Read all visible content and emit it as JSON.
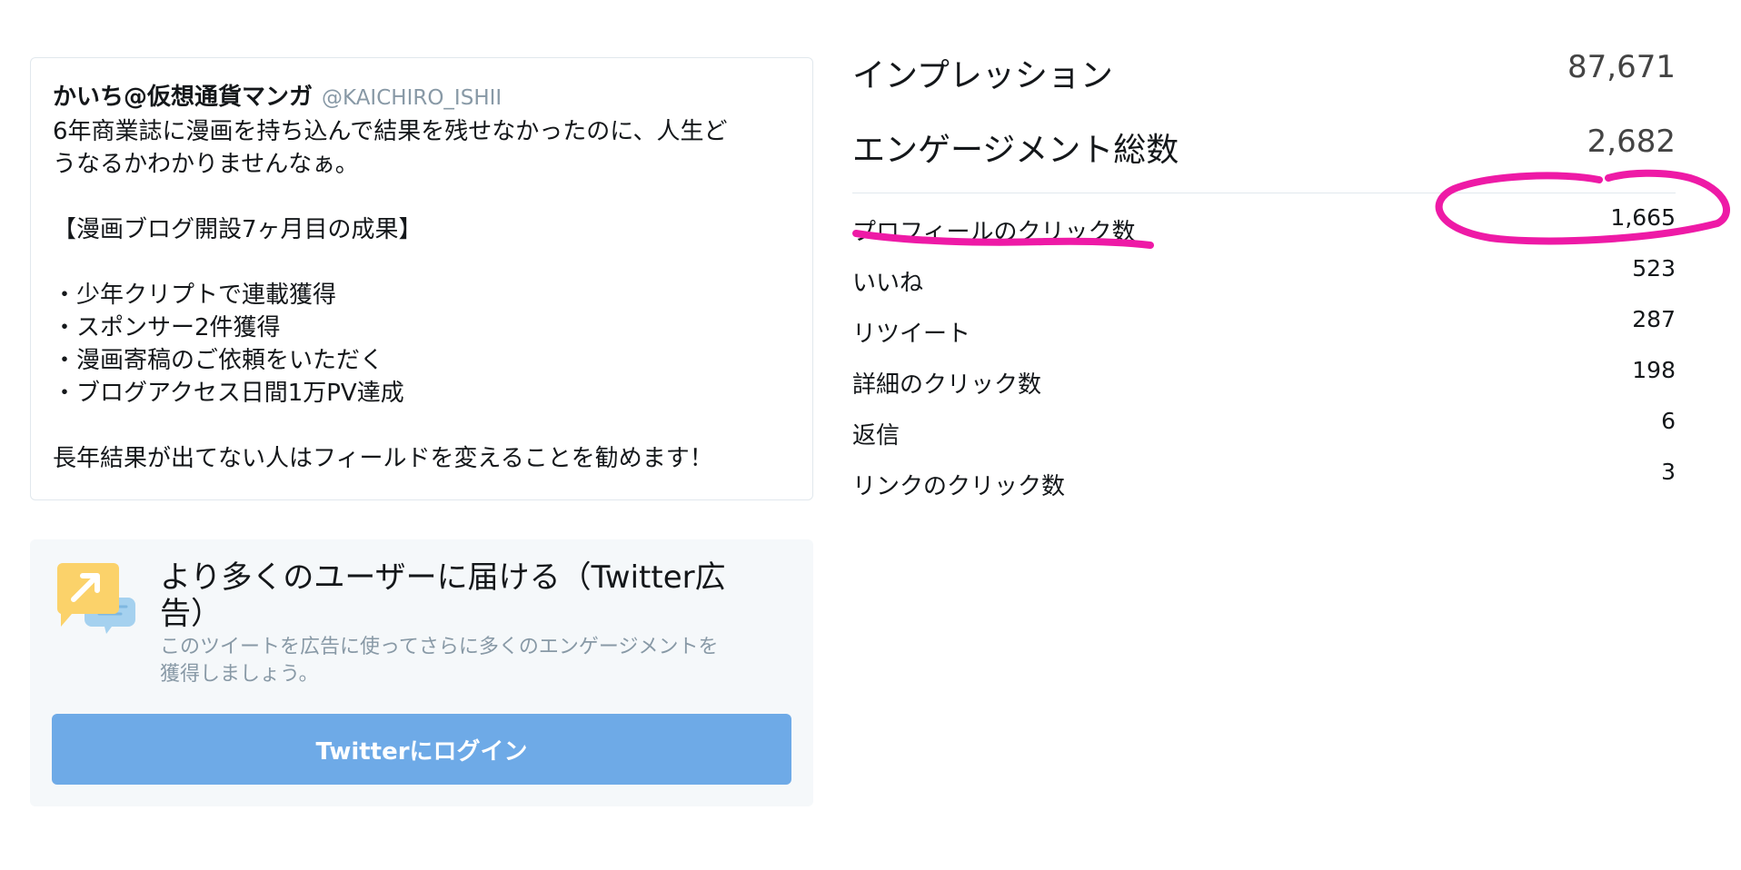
{
  "tweet": {
    "author_name": "かいち@仮想通貨マンガ",
    "author_handle": "@KAICHIRO_ISHII",
    "lines": [
      "6年商業誌に漫画を持ち込んで結果を残せなかったのに、人生ど",
      "うなるかわかりませんなぁ。",
      "",
      "【漫画ブログ開設7ヶ月目の成果】",
      "",
      "・少年クリプトで連載獲得",
      "・スポンサー2件獲得",
      "・漫画寄稿のご依頼をいただく",
      "・ブログアクセス日間1万PV達成",
      "",
      "長年結果が出てない人はフィールドを変えることを勧めます！"
    ]
  },
  "promote": {
    "title": "より多くのユーザーに届ける（Twitter広告）",
    "title_line1": "より多くのユーザーに届ける（Twitter広",
    "title_line2": "告）",
    "desc_line1": "このツイートを広告に使ってさらに多くのエンゲージメントを",
    "desc_line2": "獲得しましょう。",
    "login_label": "Twitterにログイン",
    "icon": "promote-arrow-icon",
    "icon_color": "#fbd26a",
    "bubble_color": "#a5d1ef"
  },
  "stats": {
    "impressions": {
      "label": "インプレッション",
      "value": "87,671"
    },
    "engagements": {
      "label": "エンゲージメント総数",
      "value": "2,682"
    },
    "rows": [
      {
        "label": "プロフィールのクリック数",
        "value": "1,665"
      },
      {
        "label": "いいね",
        "value": "523"
      },
      {
        "label": "リツイート",
        "value": "287"
      },
      {
        "label": "詳細のクリック数",
        "value": "198"
      },
      {
        "label": "返信",
        "value": "6"
      },
      {
        "label": "リンクのクリック数",
        "value": "3"
      }
    ]
  },
  "annotation": {
    "color": "#ee1aa6"
  },
  "colors": {
    "button_bg": "#6eaae7",
    "handle": "#8899a6",
    "border": "#e1e8ed"
  }
}
